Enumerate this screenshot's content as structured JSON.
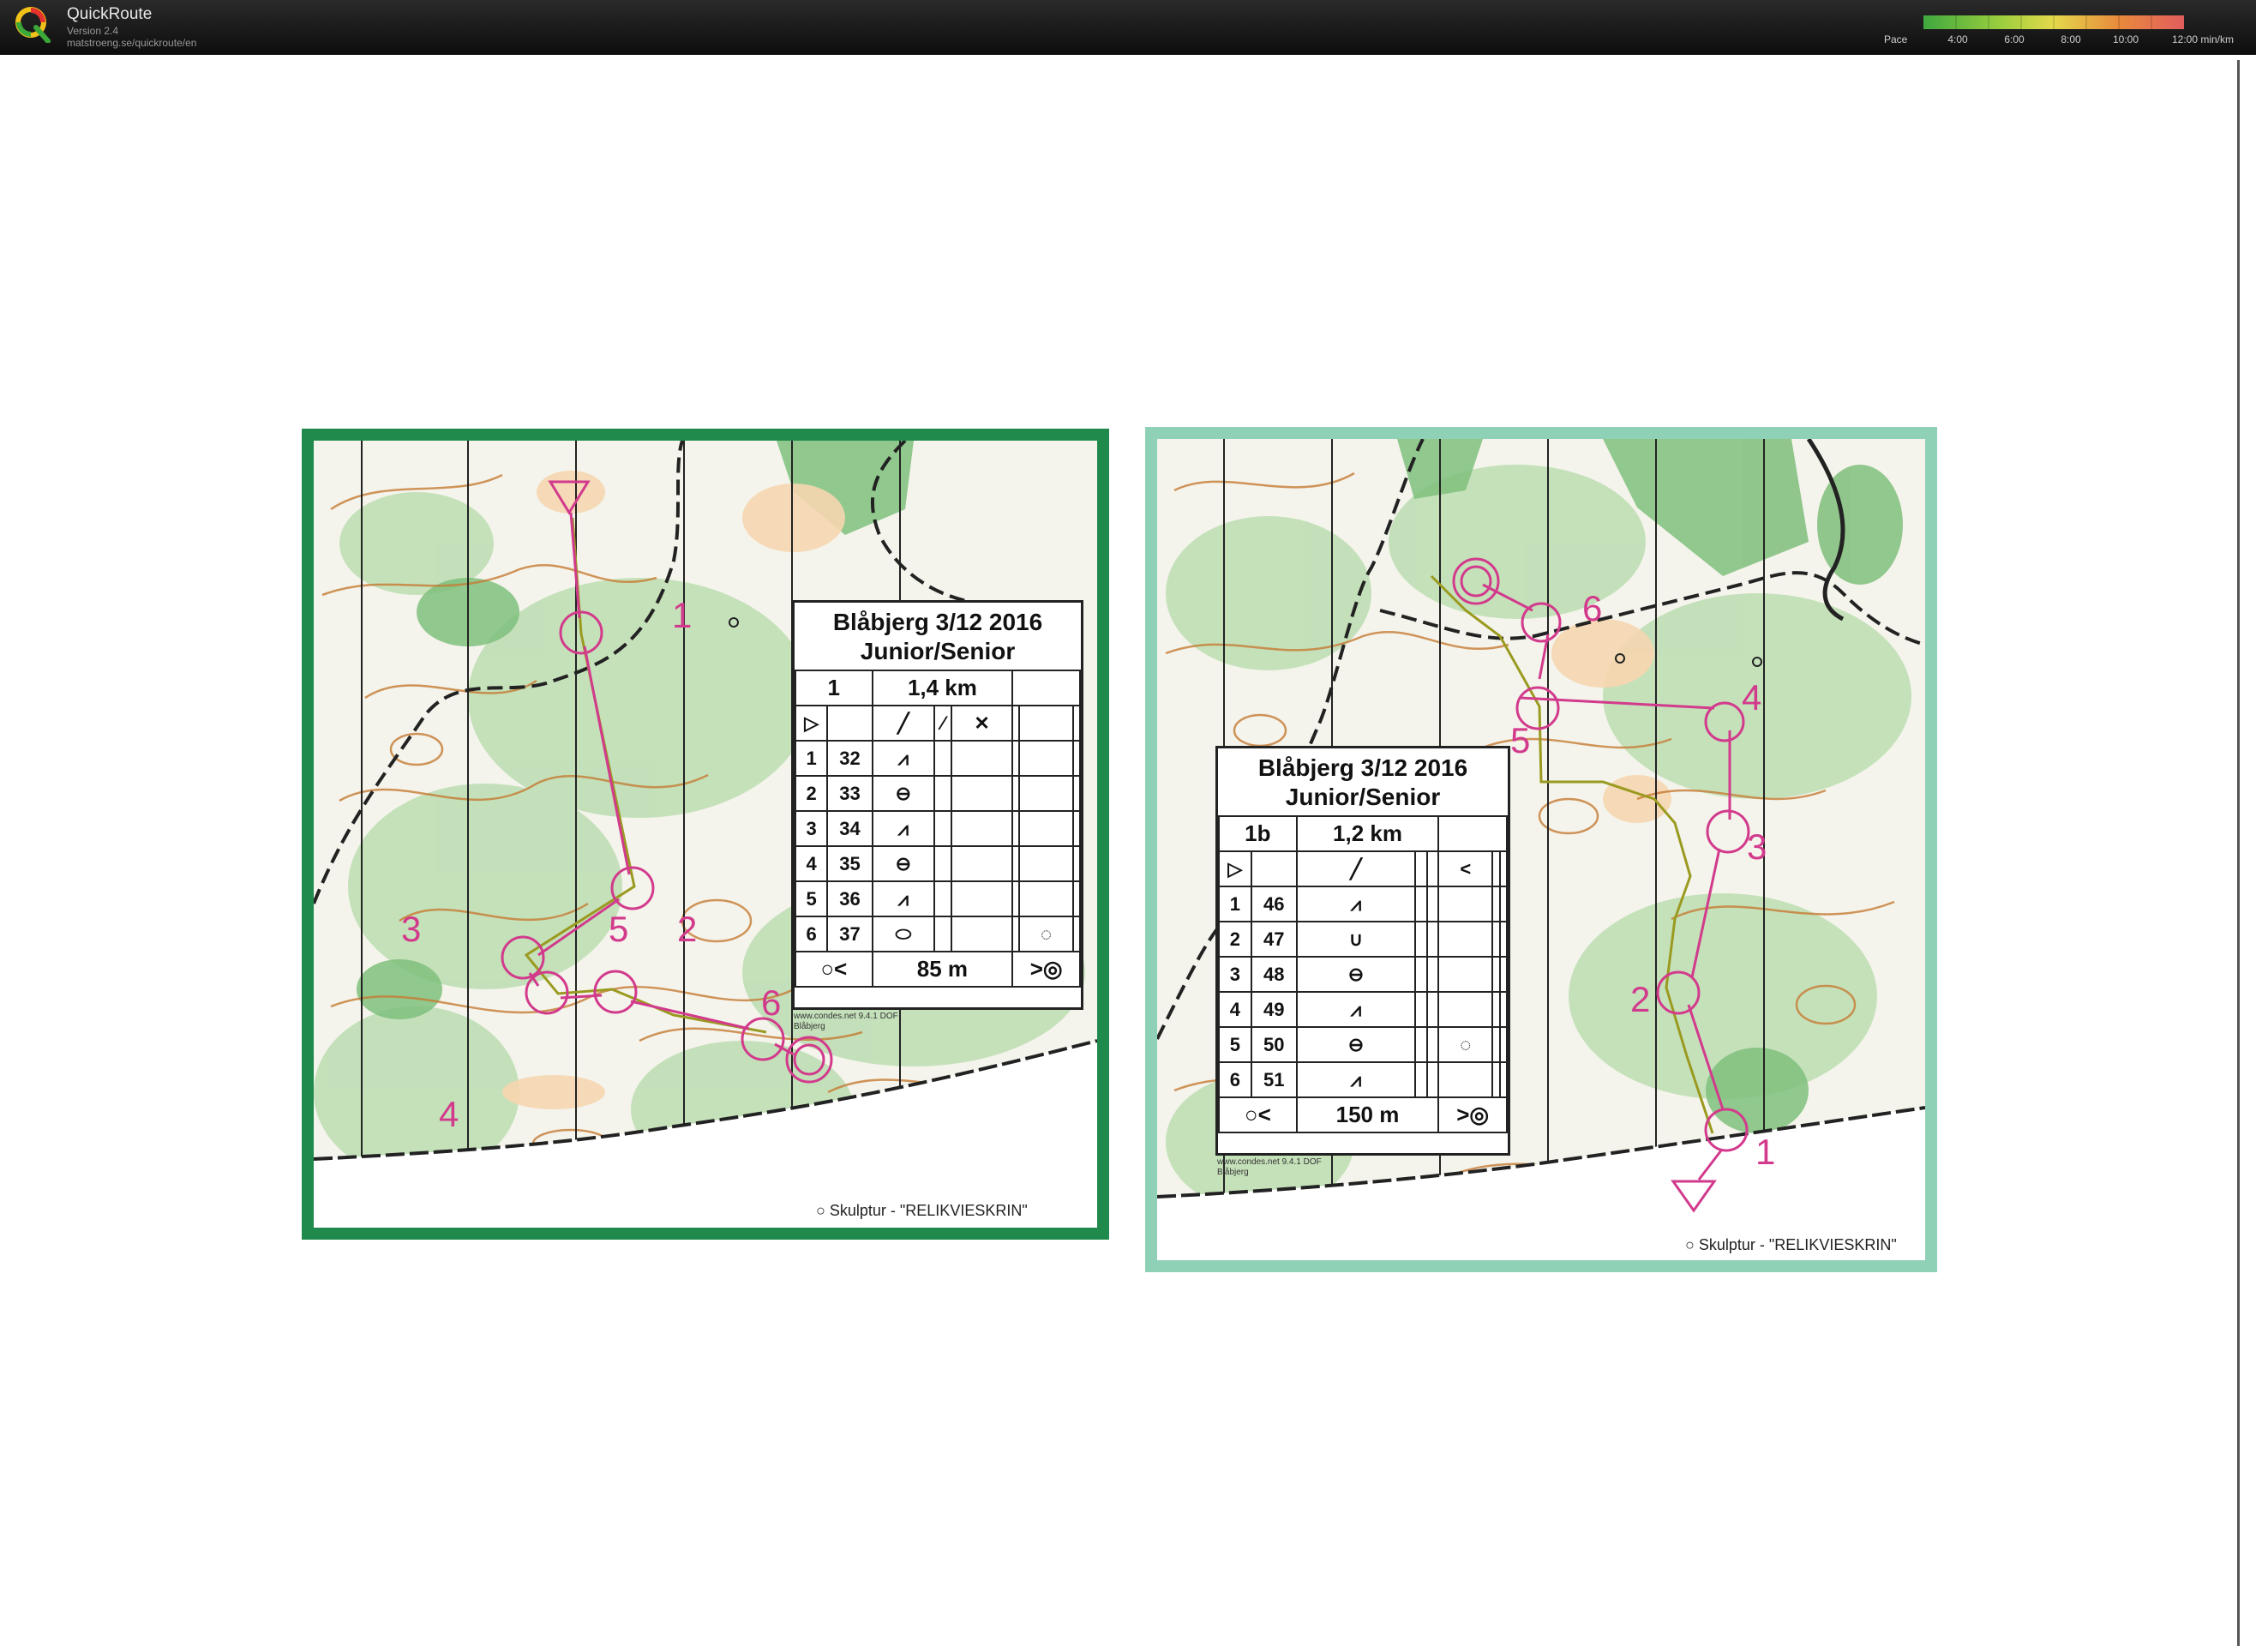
{
  "app": {
    "title": "QuickRoute",
    "version": "Version 2.4",
    "url": "matstroeng.se/quickroute/en"
  },
  "pace_legend": {
    "label": "Pace",
    "ticks": [
      "4:00",
      "6:00",
      "8:00",
      "10:00",
      "12:00  min/km"
    ],
    "colors": [
      "#3fa83f",
      "#9ccf3e",
      "#e4d84a",
      "#e88a3c",
      "#e25d5d"
    ]
  },
  "map_left": {
    "event": "Blåbjerg 3/12 2016",
    "class": "Junior/Senior",
    "course": "1",
    "length": "1,4 km",
    "controls": [
      {
        "num": "1",
        "code": "32"
      },
      {
        "num": "2",
        "code": "33"
      },
      {
        "num": "3",
        "code": "34"
      },
      {
        "num": "4",
        "code": "35"
      },
      {
        "num": "5",
        "code": "36"
      },
      {
        "num": "6",
        "code": "37"
      }
    ],
    "finish_distance": "85 m",
    "credit": "www.condes.net 9.4.1 DOF",
    "credit_place": "Blåbjerg",
    "skulptur": "Skulptur - \"RELIKVIESKRIN\""
  },
  "map_right": {
    "event": "Blåbjerg 3/12 2016",
    "class": "Junior/Senior",
    "course": "1b",
    "length": "1,2 km",
    "controls": [
      {
        "num": "1",
        "code": "46"
      },
      {
        "num": "2",
        "code": "47"
      },
      {
        "num": "3",
        "code": "48"
      },
      {
        "num": "4",
        "code": "49"
      },
      {
        "num": "5",
        "code": "50"
      },
      {
        "num": "6",
        "code": "51"
      }
    ],
    "finish_distance": "150 m",
    "credit": "www.condes.net 9.4.1 DOF",
    "credit_place": "Blåbjerg",
    "skulptur": "Skulptur - \"RELIKVIESKRIN\""
  },
  "colors": {
    "course_overprint": "#d23a8c",
    "route_line": "#9a9a20",
    "frame_left": "#1f8a4c",
    "frame_right": "#8fd1b6",
    "topbar": "#141414"
  }
}
